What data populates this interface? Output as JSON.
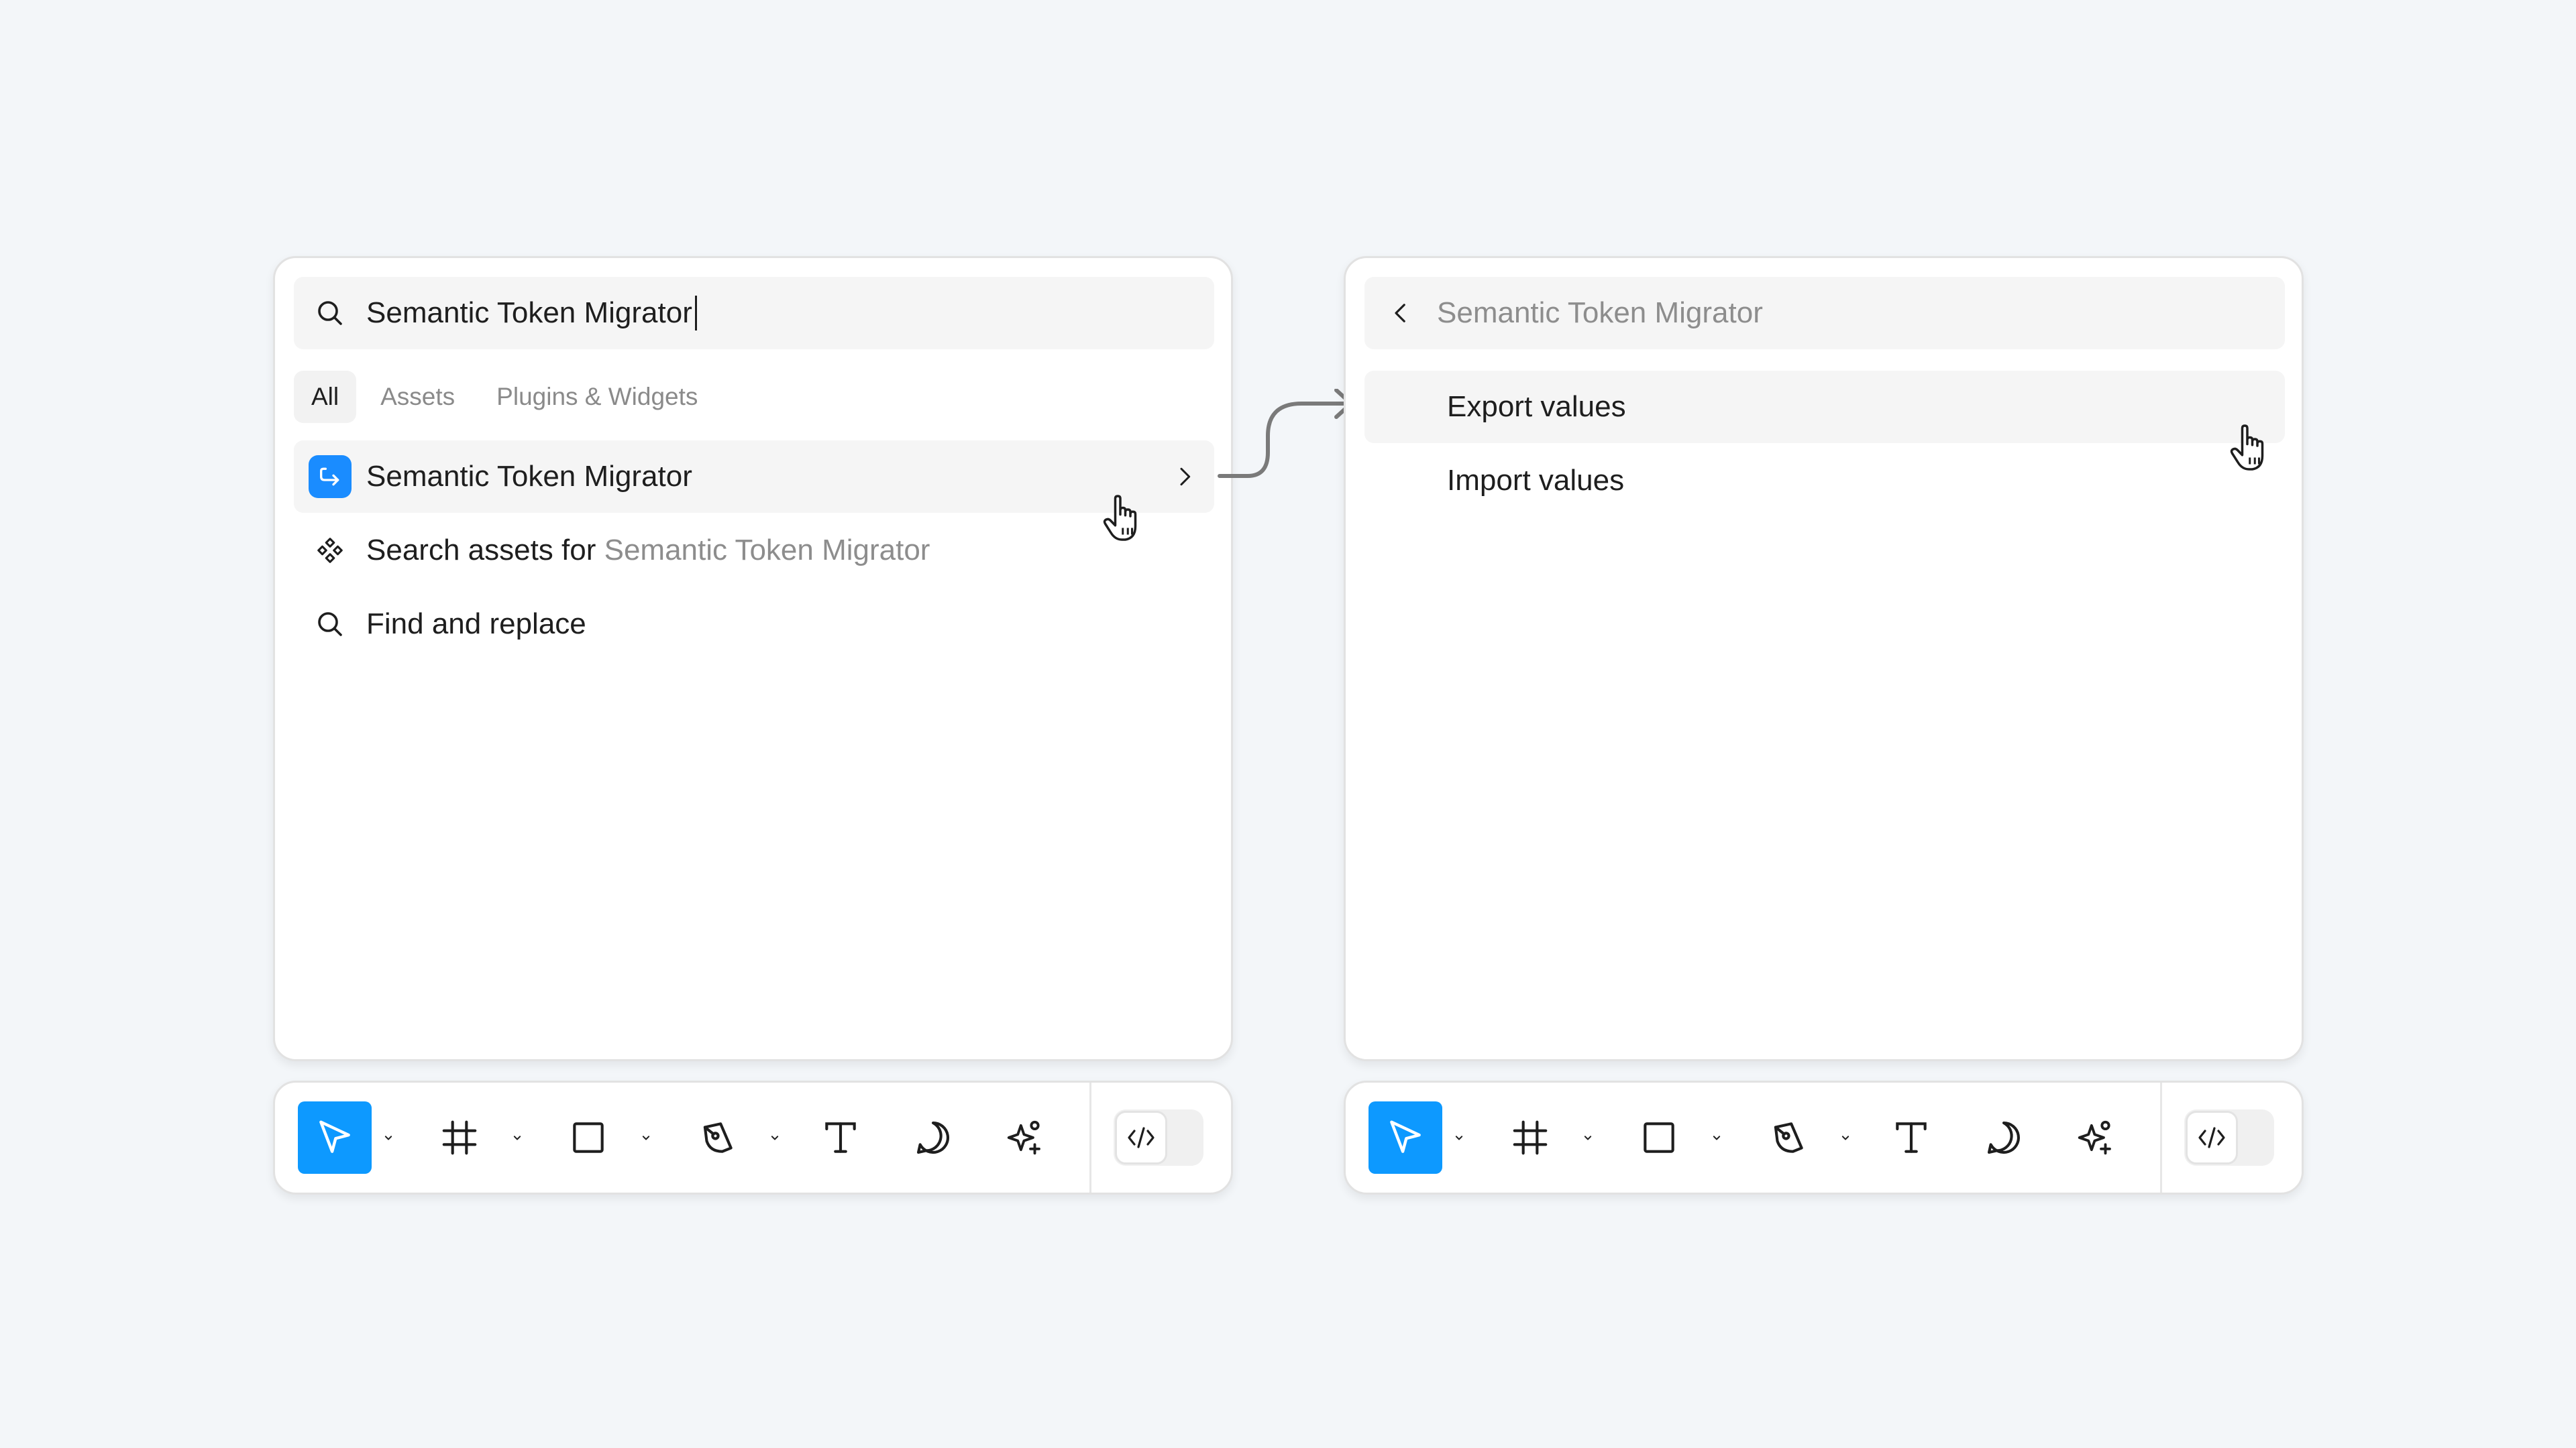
{
  "left_panel": {
    "search": {
      "value": "Semantic Token Migrator"
    },
    "tabs": [
      {
        "label": "All",
        "active": true
      },
      {
        "label": "Assets",
        "active": false
      },
      {
        "label": "Plugins & Widgets",
        "active": false
      }
    ],
    "results": [
      {
        "label": "Semantic Token Migrator",
        "icon": "plugin-icon",
        "highlighted": true,
        "has_submenu": true
      },
      {
        "label_prefix": "Search assets for ",
        "label_query": "Semantic Token Migrator",
        "icon": "component-icon"
      },
      {
        "label": "Find and replace",
        "icon": "search-icon"
      }
    ]
  },
  "right_panel": {
    "header": {
      "title": "Semantic Token Migrator",
      "back_icon": "chevron-left-icon"
    },
    "menu": [
      {
        "label": "Export values",
        "highlighted": true
      },
      {
        "label": "Import values",
        "highlighted": false
      }
    ]
  },
  "toolbar": {
    "tools": [
      {
        "name": "move-tool",
        "icon": "cursor-arrow-icon",
        "active": true,
        "has_dropdown": true
      },
      {
        "name": "frame-tool",
        "icon": "frame-hash-icon",
        "has_dropdown": true
      },
      {
        "name": "shape-tool",
        "icon": "rectangle-icon",
        "has_dropdown": true
      },
      {
        "name": "pen-tool",
        "icon": "pen-icon",
        "has_dropdown": true
      },
      {
        "name": "text-tool",
        "icon": "text-icon"
      },
      {
        "name": "comment-tool",
        "icon": "comment-icon"
      },
      {
        "name": "actions-tool",
        "icon": "sparkle-icon"
      }
    ],
    "dev_mode_icon": "code-icon"
  },
  "colors": {
    "accent": "#0d99ff",
    "plugin_badge": "#1a8cff",
    "background": "#f3f6f9",
    "muted_text": "#8d8d8d"
  }
}
